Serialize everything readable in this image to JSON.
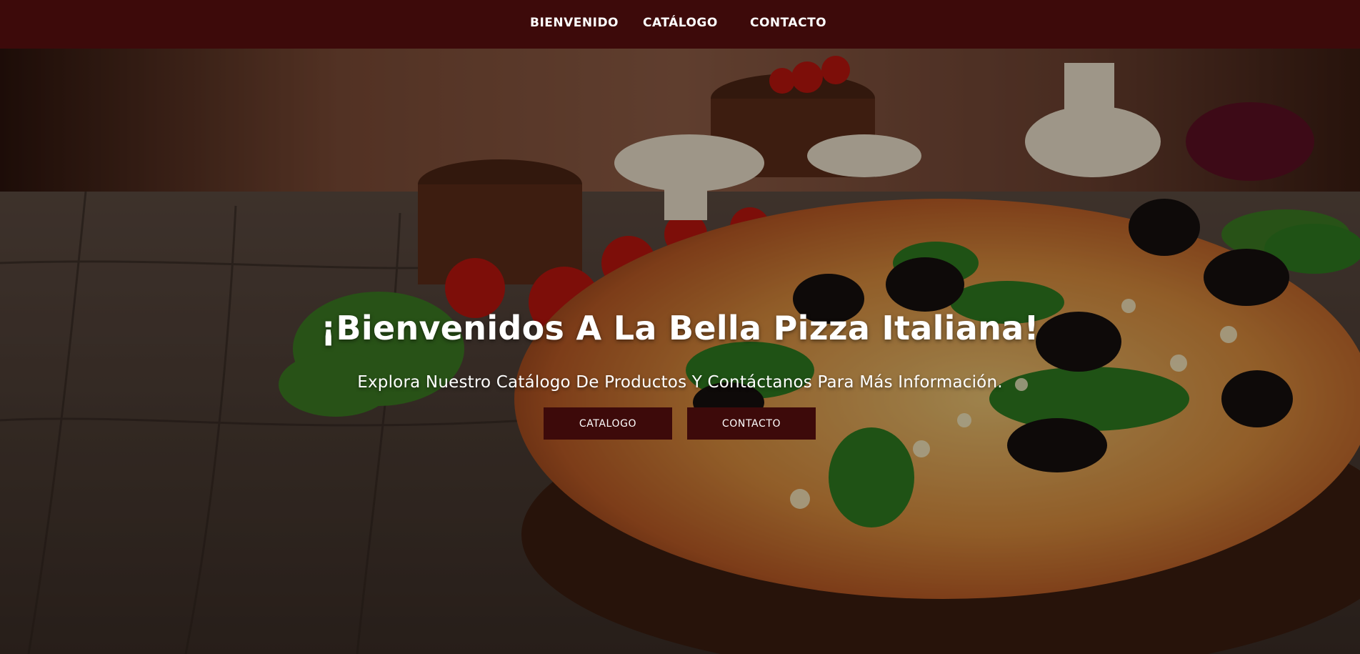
{
  "nav": {
    "items": [
      {
        "label": "BIENVENIDO"
      },
      {
        "label": "CATÁLOGO"
      },
      {
        "label": "CONTACTO"
      }
    ]
  },
  "hero": {
    "title": "¡Bienvenidos A La Bella Pizza Italiana!",
    "subtitle": "Explora Nuestro Catálogo De Productos Y Contáctanos Para Más Información.",
    "buttons": [
      {
        "label": "CATALOGO"
      },
      {
        "label": "CONTACTO"
      }
    ]
  },
  "colors": {
    "brand": "#3d0a0a",
    "text": "#ffffff"
  },
  "icons": [
    "hero-background-image"
  ]
}
